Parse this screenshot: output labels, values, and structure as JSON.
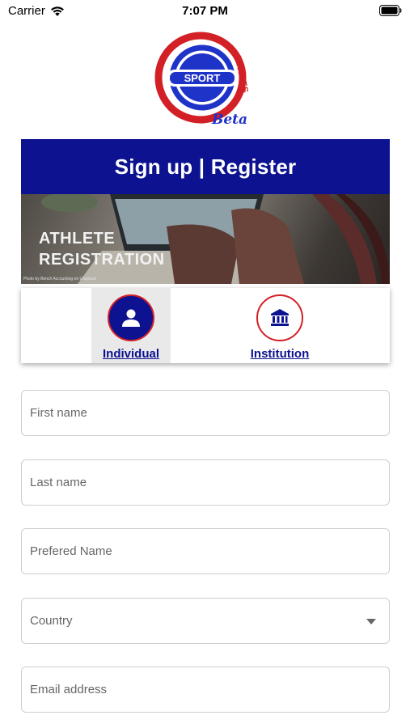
{
  "status_bar": {
    "carrier": "Carrier",
    "time": "7:07 PM",
    "icons": [
      "wifi-icon",
      "battery-icon"
    ]
  },
  "logo": {
    "sport_text": "SPORT",
    "circles_text": "CIRCLES",
    "beta_text": "Beta",
    "colors": {
      "red": "#d32027",
      "blue": "#1e33c8"
    }
  },
  "header": {
    "title": "Sign up | Register",
    "background": "#0c1290"
  },
  "banner": {
    "line1": "ATHLETE",
    "line2": "REGISTRATION",
    "credit": "Photo by Bench Accounting on Unsplash"
  },
  "account_type": {
    "selected": "Individual",
    "options": [
      {
        "label": "Individual",
        "icon": "person-icon"
      },
      {
        "label": "Institution",
        "icon": "institution-icon"
      }
    ]
  },
  "form": {
    "first_name_placeholder": "First name",
    "last_name_placeholder": "Last name",
    "preferred_name_placeholder": "Prefered Name",
    "country_placeholder": "Country",
    "email_placeholder": "Email address"
  }
}
